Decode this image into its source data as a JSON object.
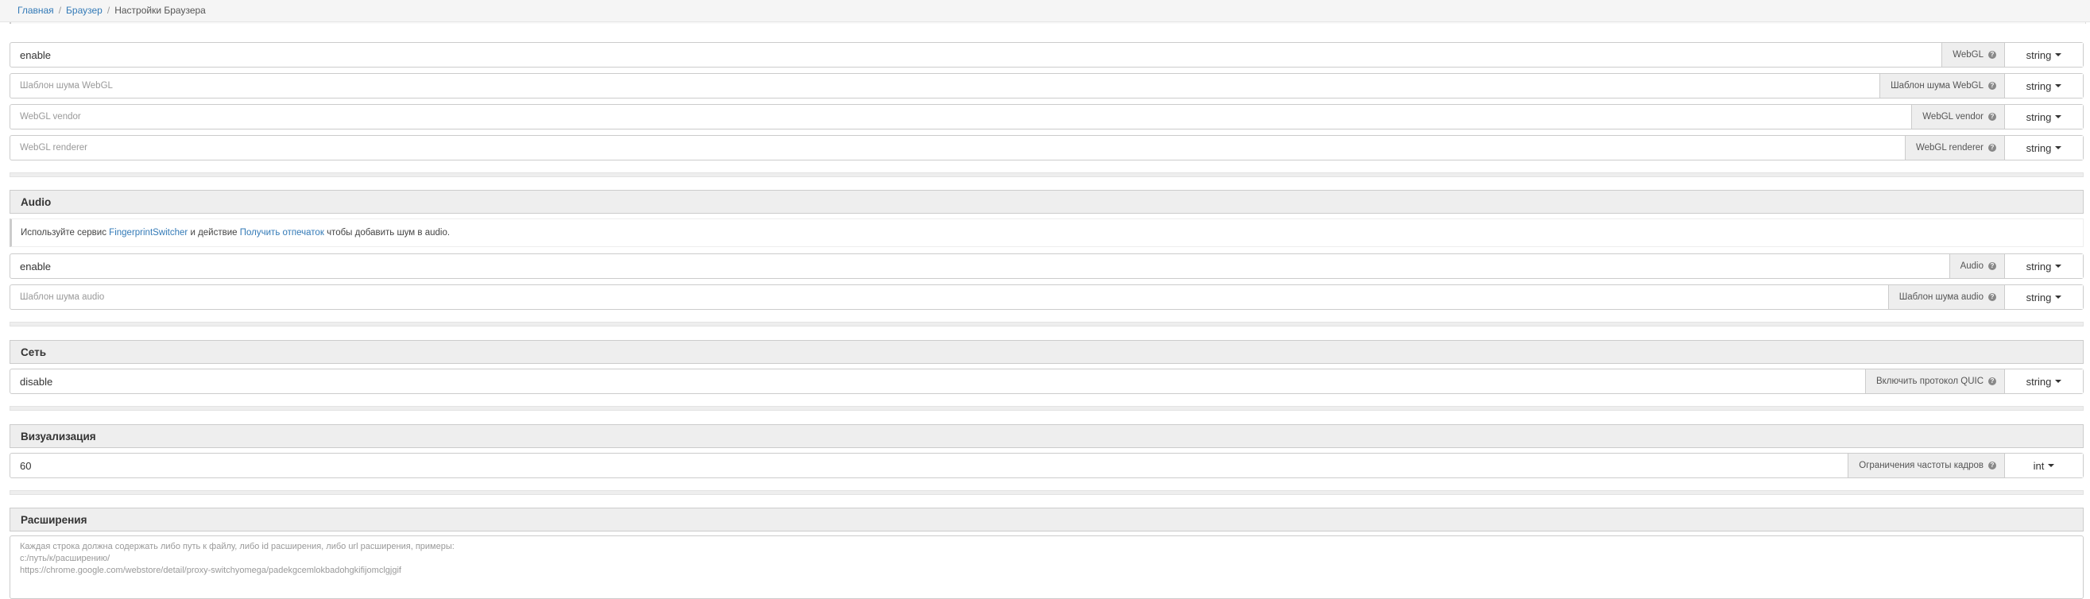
{
  "breadcrumb": {
    "home": "Главная",
    "browser": "Браузер",
    "current": "Настройки Браузера"
  },
  "webgl": {
    "value": "enable",
    "label": "WebGL",
    "type": "string",
    "noise_placeholder": "Шаблон шума WebGL",
    "noise_label": "Шаблон шума WebGL",
    "noise_type": "string",
    "vendor_placeholder": "WebGL vendor",
    "vendor_label": "WebGL vendor",
    "vendor_type": "string",
    "renderer_placeholder": "WebGL renderer",
    "renderer_label": "WebGL renderer",
    "renderer_type": "string"
  },
  "audio": {
    "title": "Audio",
    "note_prefix": "Используйте сервис",
    "note_link1": "FingerprintSwitcher",
    "note_mid": "и действие",
    "note_link2": "Получить отпечаток",
    "note_suffix": "чтобы добавить шум в audio.",
    "value": "enable",
    "label": "Audio",
    "type": "string",
    "noise_placeholder": "Шаблон шума audio",
    "noise_label": "Шаблон шума audio",
    "noise_type": "string"
  },
  "network": {
    "title": "Сеть",
    "value": "disable",
    "label": "Включить протокол QUIC",
    "type": "string"
  },
  "visualization": {
    "title": "Визуализация",
    "value": "60",
    "label": "Ограничения частоты кадров",
    "type": "int"
  },
  "extensions": {
    "title": "Расширения",
    "placeholder_lines": [
      "Каждая строка должна содержать либо путь к файлу, либо id расширения, либо url расширения, примеры:",
      "c:/путь/к/расширению/",
      "https://chrome.google.com/webstore/detail/proxy-switchyomega/padekgcemlokbadohgkifijomclgjgif"
    ]
  },
  "icons": {
    "help": "question-circle-icon",
    "caret": "caret-down-icon"
  }
}
